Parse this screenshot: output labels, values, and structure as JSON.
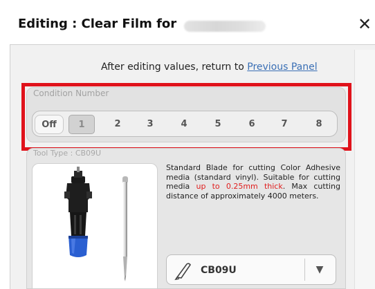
{
  "window": {
    "title": "Editing : Clear Film for",
    "close_glyph": "✕"
  },
  "notice": {
    "prefix": "After editing values, return to ",
    "link": "Previous Panel"
  },
  "condition": {
    "label": "Condition Number",
    "off_label": "Off",
    "selected": "1",
    "numbers": [
      "1",
      "2",
      "3",
      "4",
      "5",
      "6",
      "7",
      "8"
    ]
  },
  "tool": {
    "label": "Tool Type : CB09U",
    "description_part1": "Standard Blade for cutting Color Adhesive media (standard vinyl). Suitable for cutting media ",
    "description_red": "up to 0.25mm thick",
    "description_part2": ". Max cutting distance of approximately 4000 meters.",
    "blade_value": "CB09U",
    "dropdown_glyph": "▼"
  },
  "colors": {
    "highlight": "#e0121b",
    "link": "#3a6fb5",
    "warning_text": "#e01d1d",
    "blade_blue": "#2a5fd1"
  },
  "icons": [
    "close-icon",
    "blade-icon",
    "chevron-down-icon",
    "cutter-holder-image",
    "blade-image"
  ]
}
